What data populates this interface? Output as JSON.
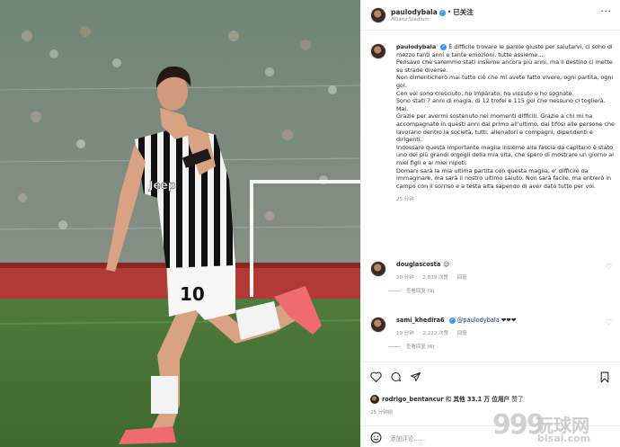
{
  "header": {
    "username": "paulodybala",
    "separator": "•",
    "follow_status": "已关注",
    "location": "Allianz Stadium",
    "more": "···"
  },
  "caption": {
    "username": "paulodybala",
    "lines": [
      "È difficile trovare le parole giuste per salutarvi, ci sono di mezzo tanti anni e tante emozioni, tutte assieme...",
      "Pensavo che saremmo stati insieme ancora più anni, ma il destino ci mette su strade diverse.",
      "Non dimenticherò mai tutto ciò che mi avete fatto vivere, ogni partita, ogni gol.",
      "Con voi sono cresciuto, ho imparato, ho vissuto e ho sognato.",
      "Sono stati 7 anni di magia, di 12 trofei e 115 gol che nessuno ci toglierà. Mai.",
      "Grazie per avermi sostenuto nei momenti difficili. Grazie a chi mi ha accompagnato in questi anni dal primo all'ultimo, dai tifosi alle persone che lavorano dentro la società, tutti, allenatori e compagni, dipendenti e dirigenti.",
      "Indossare questa importante maglia insieme alla fascia da capitano è stato uno dei più grandi orgogli della mia vita, che spero di mostrare un giorno ai miei figli e ai miei nipoti.",
      "Domani sarà la mia ultima partita con questa maglia, e' difficile da immaginare, ma sarà il nostro ultimo saluto. Non sarà facile, ma entrerò in campo con il sorriso e a testa alta sapendo di aver dato tutto per voi."
    ],
    "time": "25 分钟"
  },
  "comments": [
    {
      "username": "douglascosta",
      "text": "",
      "emoji": "☺",
      "time": "20 分钟",
      "likes": "2,839 次赞",
      "reply": "回复",
      "view_replies": "查看回复 (9)"
    },
    {
      "username": "sami_khedira6",
      "mention": "@paulodybala",
      "text": "❤❤❤",
      "time": "19 分钟",
      "likes": "2,222 次赞",
      "reply": "回复",
      "view_replies": "查看回复 (6)"
    }
  ],
  "likes_line": {
    "user": "rodrigo_bentancur",
    "middle": "和",
    "others": "其他 33.1 万 位用户",
    "suffix": "赞了"
  },
  "post_time": "25 分钟前",
  "add_comment_placeholder": "添加评论......",
  "jersey_number": "10",
  "jersey_sponsor": "Jeep",
  "watermark": {
    "digits": "999",
    "cn": "玩球网",
    "url": "bisai.com"
  },
  "colors": {
    "verified": "#3897f0",
    "link": "#00376b",
    "muted": "#8e8e8e",
    "text": "#262626"
  }
}
